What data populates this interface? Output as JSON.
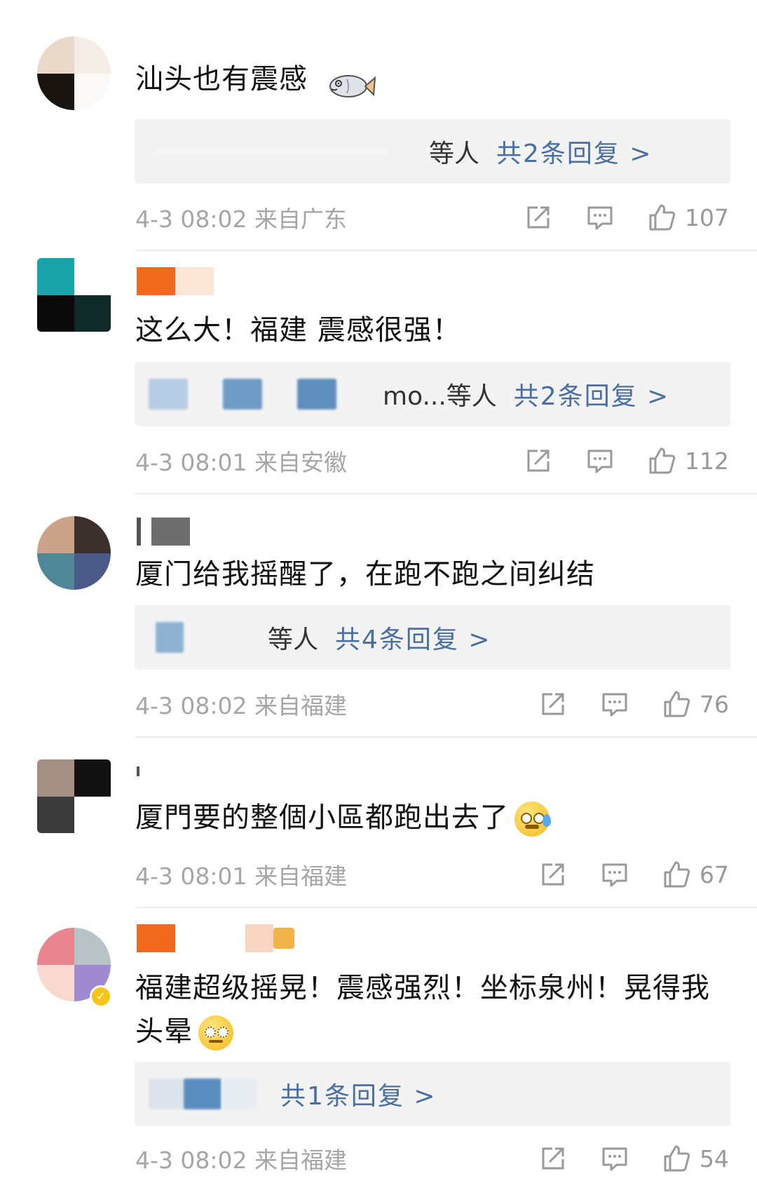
{
  "comments": [
    {
      "text": "汕头也有震感",
      "reply_who": "等人",
      "reply_count": "共2条回复 >",
      "time": "4-3 08:02 来自广东",
      "likes": "107",
      "has_fish_sticker": true
    },
    {
      "text": "这么大！福建 震感很强！",
      "reply_who": "mo...等人",
      "reply_count": "共2条回复 >",
      "time": "4-3 08:01 来自安徽",
      "likes": "112"
    },
    {
      "text": "厦门给我摇醒了，在跑不跑之间纠结",
      "reply_who": "等人",
      "reply_count": "共4条回复 >",
      "time": "4-3 08:02 来自福建",
      "likes": "76"
    },
    {
      "text": "厦門要的整個小區都跑出去了",
      "time": "4-3 08:01 来自福建",
      "likes": "67",
      "emoji": "cold-sweat-emoji"
    },
    {
      "text_line1": "福建超级摇晃！震感强烈！坐标泉州！晃得我",
      "text_line2": "头晕",
      "reply_count": "共1条回复 >",
      "time": "4-3 08:02 来自福建",
      "likes": "54",
      "emoji": "dizzy-emoji"
    }
  ],
  "icons": {
    "share": "share-icon",
    "comment": "comment-icon",
    "like": "thumbs-up-icon"
  },
  "colors": {
    "reply_link": "#4a6fa5",
    "meta_gray": "#a6a6a6",
    "reply_bg": "#f3f3f3"
  }
}
